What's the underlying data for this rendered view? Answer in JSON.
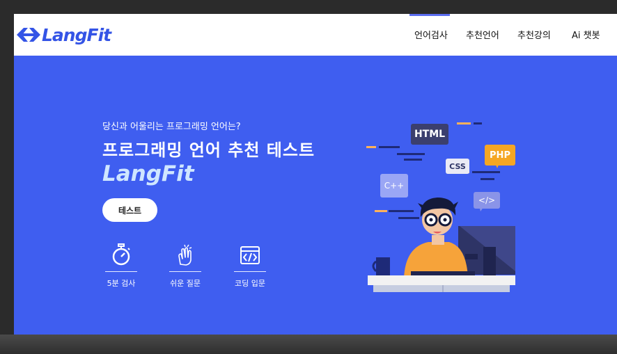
{
  "header": {
    "logo_text": "LangFit",
    "nav": [
      {
        "label": "언어검사"
      },
      {
        "label": "추천언어"
      },
      {
        "label": "추천강의"
      },
      {
        "label": "Ai 챗봇"
      }
    ]
  },
  "hero": {
    "subtitle": "당신과 어울리는 프로그래밍 언어는?",
    "title": "프로그래밍 언어 추천 테스트",
    "brand": "LangFit",
    "button_label": "테스트"
  },
  "features": [
    {
      "icon": "stopwatch-icon",
      "label": "5분 검사"
    },
    {
      "icon": "hand-gesture-icon",
      "label": "쉬운 질문"
    },
    {
      "icon": "code-window-icon",
      "label": "코딩 입문"
    }
  ],
  "illustration": {
    "bubbles": [
      {
        "text": "HTML"
      },
      {
        "text": "PHP"
      },
      {
        "text": "CSS"
      },
      {
        "text": "C++"
      },
      {
        "text": "</>"
      }
    ]
  },
  "colors": {
    "hero_bg": "#3f5ef0",
    "brand_text": "#cfe6ff",
    "logo": "#3454e6"
  }
}
